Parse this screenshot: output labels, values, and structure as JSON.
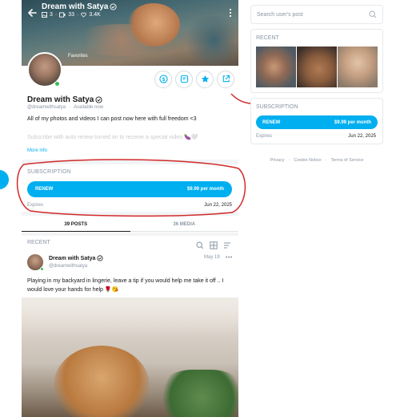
{
  "colors": {
    "accent": "#00aff0",
    "online": "#3dbb5a",
    "annotation": "#d22a2a"
  },
  "cover": {
    "name": "Dream with Satya",
    "verified_icon": "verified-badge-icon",
    "stats": {
      "posts": "3",
      "media": "33",
      "likes": "3.4K"
    },
    "favorites_label": "Favorites"
  },
  "profile": {
    "name": "Dream with Satya",
    "handle": "@dreamwithsatya",
    "status": "Available now",
    "bio": "All of my photos and videos I can post now here with full freedom <3",
    "bio_faded": "Subscribe with auto renew turned on to receive a special video 🍆🤍",
    "more_info": "More info",
    "actions": [
      "tip-icon",
      "message-icon",
      "favorite-star-icon",
      "share-icon"
    ]
  },
  "subscription": {
    "title": "SUBSCRIPTION",
    "renew_label": "RENEW",
    "price": "$9.99 per month",
    "expires_label": "Expires",
    "expires_date": "Jun 22, 2025"
  },
  "tabs": [
    {
      "label": "39 POSTS",
      "active": true
    },
    {
      "label": "36 MEDIA",
      "active": false
    }
  ],
  "recent": {
    "label": "RECENT",
    "tools": [
      "search-icon",
      "grid-icon",
      "sort-icon"
    ]
  },
  "post": {
    "name": "Dream with Satya",
    "handle": "@dreamwithsatya",
    "date": "May 19",
    "more": "•••",
    "text": "Playing in my backyard in lingerie, leave a tip if you would help me take it off .. I would love your hands for help 🌹😘"
  },
  "sidebar": {
    "search_placeholder": "Search user's post",
    "recent_label": "RECENT",
    "subscription_title": "SUBSCRIPTION",
    "renew_label": "RENEW",
    "price": "$9.99 per month",
    "expires_label": "Expires",
    "expires_date": "Jun 22, 2025",
    "footer": [
      "Privacy",
      "·",
      "Cookie Notice",
      "·",
      "Terms of Service"
    ]
  }
}
